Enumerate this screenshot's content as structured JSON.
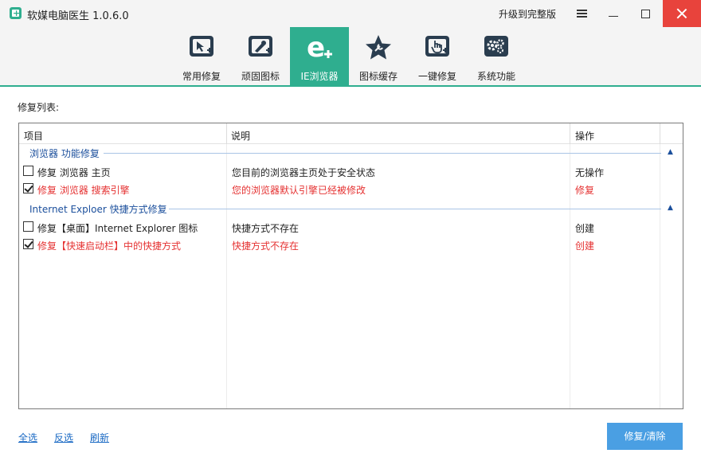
{
  "window": {
    "title": "软媒电脑医生 1.0.6.0",
    "upgrade_label": "升级到完整版"
  },
  "colors": {
    "accent": "#2fae8f",
    "close": "#e8433c",
    "link": "#1b6ac4",
    "group": "#1b4f9c",
    "alert": "#e53232",
    "button": "#4a9fe3"
  },
  "tabs": [
    {
      "label": "常用修复",
      "icon": "cursor-repair-icon"
    },
    {
      "label": "顽固图标",
      "icon": "brush-icon"
    },
    {
      "label": "IE浏览器",
      "icon": "ie-browser-icon",
      "active": true
    },
    {
      "label": "图标缓存",
      "icon": "star-wrench-icon"
    },
    {
      "label": "一键修复",
      "icon": "hand-click-icon"
    },
    {
      "label": "系统功能",
      "icon": "gears-icon"
    }
  ],
  "section_label": "修复列表:",
  "columns": {
    "item": "项目",
    "desc": "说明",
    "op": "操作"
  },
  "groups": [
    {
      "title": "浏览器 功能修复",
      "rows": [
        {
          "checked": false,
          "item": "修复 浏览器 主页",
          "desc": "您目前的浏览器主页处于安全状态",
          "op": "无操作"
        },
        {
          "checked": true,
          "item": "修复 浏览器 搜索引擎",
          "desc": "您的浏览器默认引擎已经被修改",
          "op": "修复"
        }
      ]
    },
    {
      "title": "Internet Exploer 快捷方式修复",
      "rows": [
        {
          "checked": false,
          "item": "修复【桌面】Internet Explorer 图标",
          "desc": "快捷方式不存在",
          "op": "创建"
        },
        {
          "checked": true,
          "item": "修复【快速启动栏】中的快捷方式",
          "desc": "快捷方式不存在",
          "op": "创建"
        }
      ]
    }
  ],
  "footer": {
    "select_all": "全选",
    "invert": "反选",
    "refresh": "刷新",
    "repair_button": "修复/清除"
  }
}
